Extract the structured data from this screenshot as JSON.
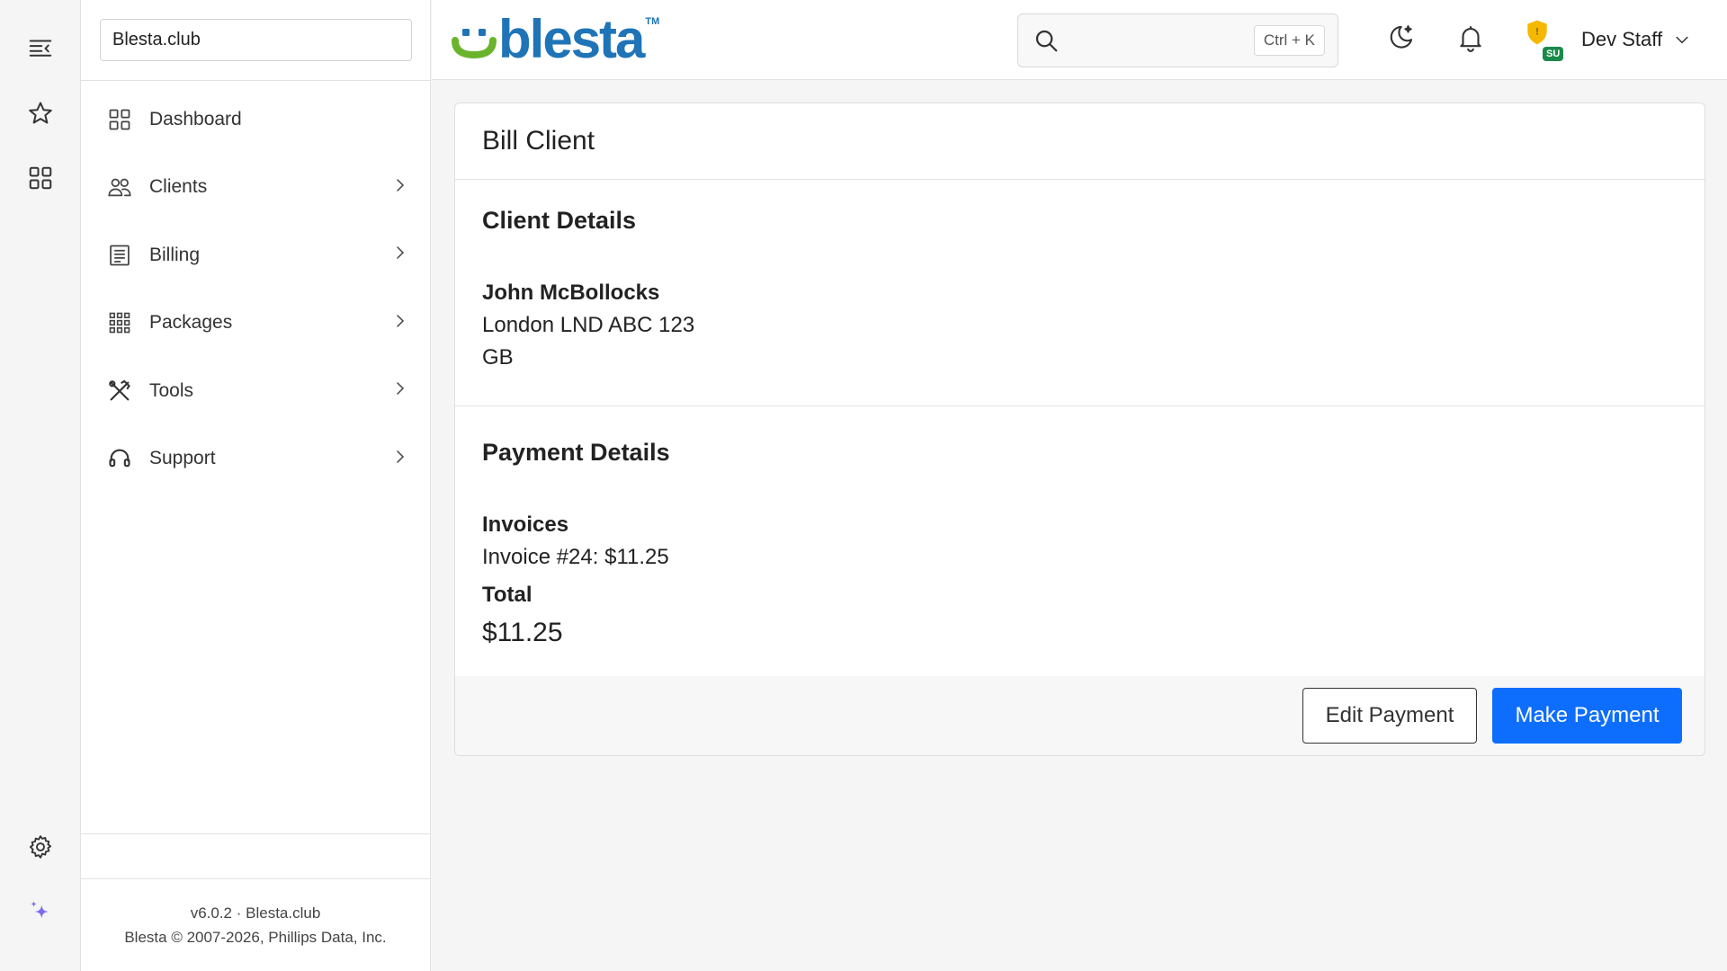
{
  "sidebar": {
    "company": "Blesta.club",
    "items": [
      {
        "label": "Dashboard",
        "icon": "dashboard-grid-icon",
        "has_children": false
      },
      {
        "label": "Clients",
        "icon": "users-icon",
        "has_children": true
      },
      {
        "label": "Billing",
        "icon": "billing-list-icon",
        "has_children": true
      },
      {
        "label": "Packages",
        "icon": "packages-dots-icon",
        "has_children": true
      },
      {
        "label": "Tools",
        "icon": "tools-icon",
        "has_children": true
      },
      {
        "label": "Support",
        "icon": "headset-icon",
        "has_children": true
      }
    ],
    "footer_version": "v6.0.2 · Blesta.club",
    "footer_copyright": "Blesta © 2007-2026, Phillips Data, Inc."
  },
  "header": {
    "logo_text": "blesta",
    "logo_tm": "TM",
    "search_shortcut": "Ctrl + K",
    "su_badge": "SU",
    "user_name": "Dev Staff"
  },
  "page": {
    "title": "Bill Client",
    "client_section_title": "Client Details",
    "client_name": "John McBollocks",
    "client_address": "London LND ABC 123",
    "client_country": "GB",
    "payment_section_title": "Payment Details",
    "invoices_label": "Invoices",
    "invoice_line": "Invoice #24: $11.25",
    "total_label": "Total",
    "total_value": "$11.25",
    "edit_button": "Edit Payment",
    "make_button": "Make Payment"
  },
  "colors": {
    "primary": "#0d6efd",
    "logo_blue": "#1f74b7",
    "logo_green": "#6ab42d",
    "su_badge": "#1a8a4a",
    "shield": "#f5b800",
    "sparkle": "#7b6cf0"
  }
}
